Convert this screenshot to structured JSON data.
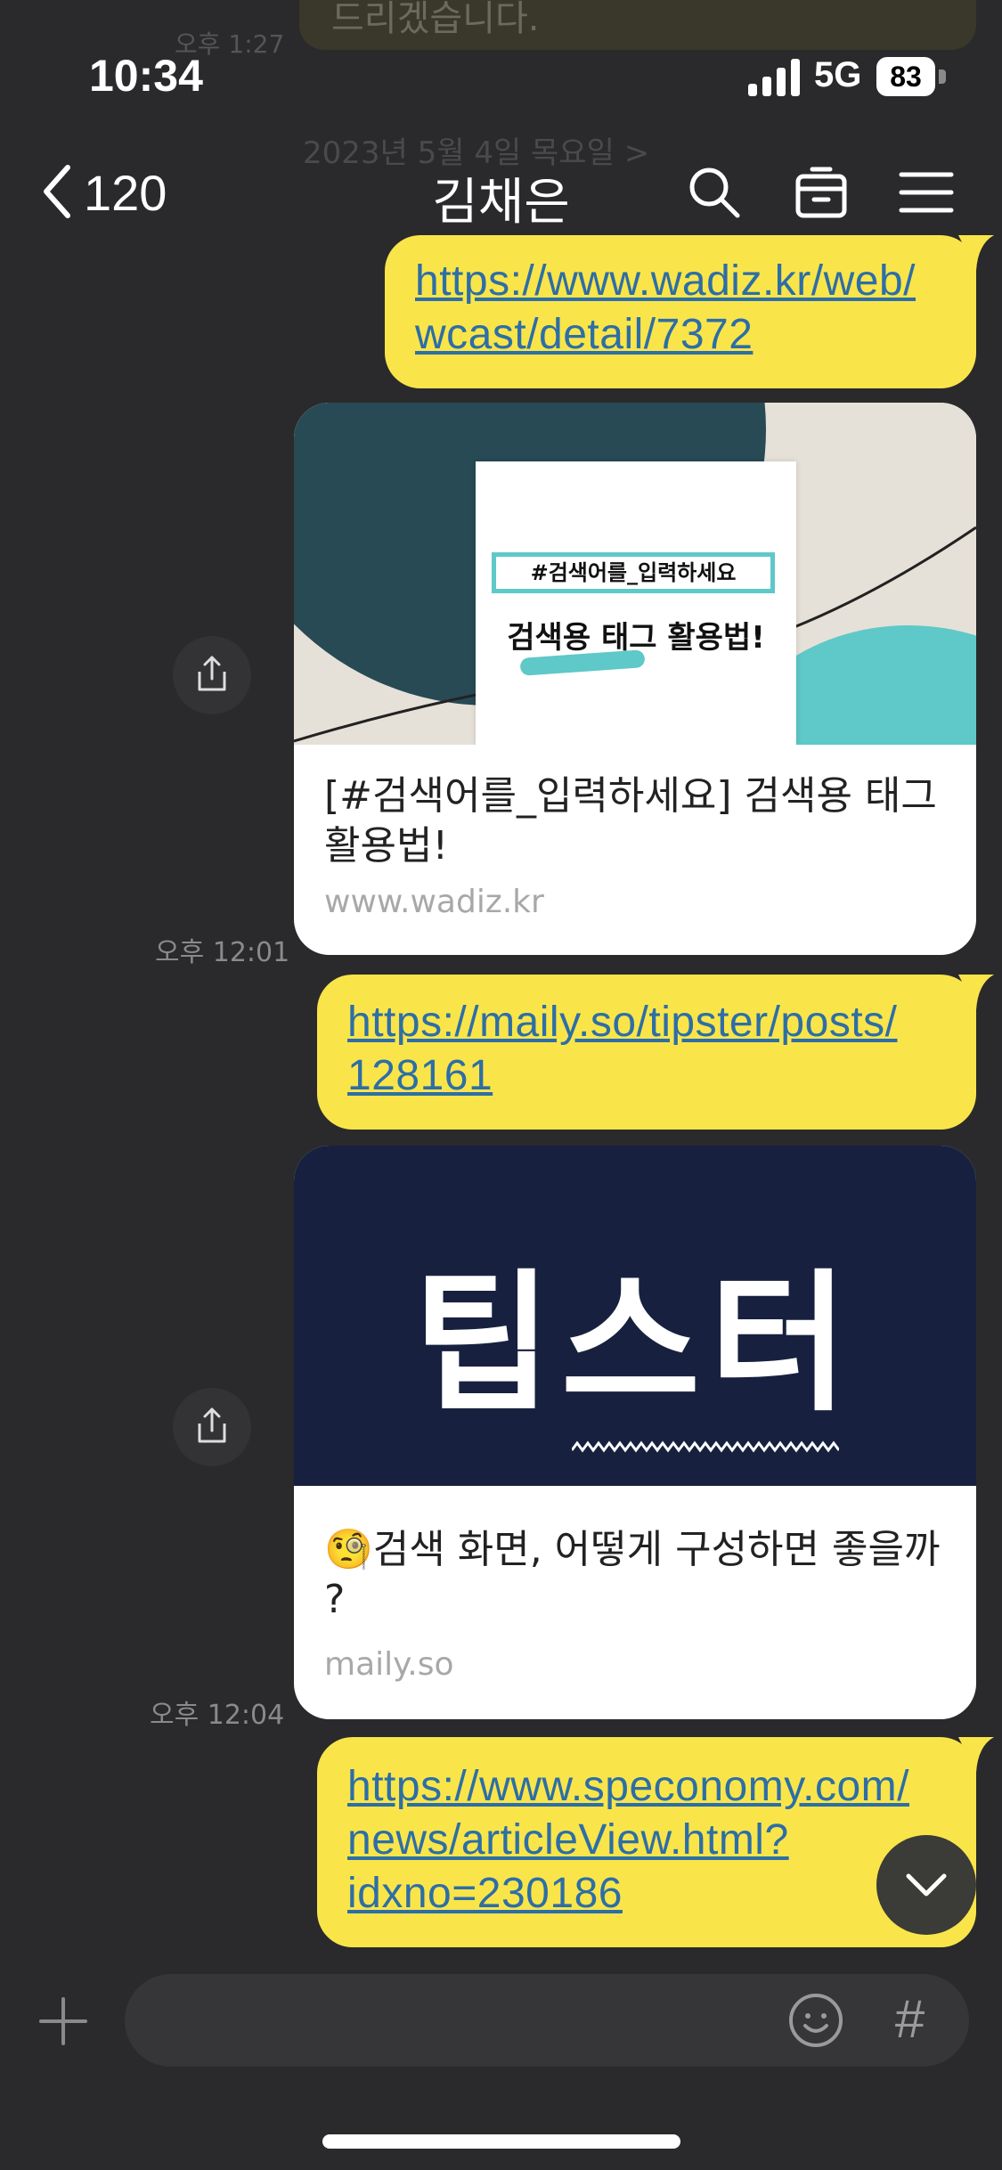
{
  "ghost": {
    "bubble_text": "드리겠습니다.",
    "time": "오후 1:27",
    "date_label": "2023년 5월 4일 목요일 >"
  },
  "status_bar": {
    "time": "10:34",
    "network": "5G",
    "battery": "83"
  },
  "header": {
    "back_count": "120",
    "title": "김채은",
    "icons": [
      "search-icon",
      "calendar-icon",
      "menu-icon"
    ]
  },
  "messages": [
    {
      "type": "link",
      "line1": "https://www.wadiz.kr/web/",
      "line2": "wcast/detail/7372"
    },
    {
      "type": "card",
      "thumb_tag": "#검색어를_입력하세요",
      "thumb_title": "검색용 태그 활용법!",
      "title_line1": "[#검색어를_입력하세요] 검색용 태그",
      "title_line2": "활용법!",
      "domain": "www.wadiz.kr",
      "time": "오후 12:01"
    },
    {
      "type": "link",
      "line1": "https://maily.so/tipster/posts/",
      "line2": "128161"
    },
    {
      "type": "card",
      "thumb_title": "팁스터",
      "title_line1": "검색 화면, 어떻게 구성하면 좋을까",
      "title_line2": "?",
      "domain": "maily.so",
      "time": "오후 12:04"
    },
    {
      "type": "link",
      "line1": "https://www.speconomy.com/",
      "line2": "news/articleView.html?",
      "line3": "idxno=230186"
    }
  ],
  "input": {
    "placeholder": "",
    "hash_label": "#"
  },
  "colors": {
    "background": "#2a2a2c",
    "bubble": "#f9e54a",
    "link": "#2d6ea6",
    "card_dark_teal": "#274a55",
    "card_navy": "#17213f"
  }
}
